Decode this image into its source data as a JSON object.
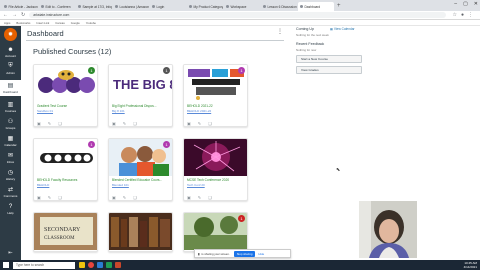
{
  "browser": {
    "tabs": [
      "File Article - Jackson Flo",
      "Edit to - Conferen",
      "Sample at 17/3, Infopage",
      "Louisianna | Amazon pres",
      "Login",
      "My Product Category",
      "Workspace",
      "Lesson 6 Discussion Posted",
      "Dashboard"
    ],
    "active_tab_index": 8,
    "url": "arkstate.instructure.com",
    "bookmarks": [
      "Apps",
      "Bookmarks",
      "Insert Link",
      "Canvas",
      "Google",
      "Youtube"
    ]
  },
  "global_nav": {
    "items": [
      {
        "label": "Account",
        "icon": "user-circle-icon"
      },
      {
        "label": "Admin",
        "icon": "shield-icon"
      },
      {
        "label": "Dashboard",
        "icon": "dashboard-icon"
      },
      {
        "label": "Courses",
        "icon": "book-icon"
      },
      {
        "label": "Groups",
        "icon": "users-icon"
      },
      {
        "label": "Calendar",
        "icon": "calendar-icon"
      },
      {
        "label": "Inbox",
        "icon": "inbox-icon"
      },
      {
        "label": "History",
        "icon": "clock-icon"
      },
      {
        "label": "Commons",
        "icon": "arrows-icon"
      },
      {
        "label": "Help",
        "icon": "help-icon"
      }
    ],
    "active_index": 2
  },
  "dashboard": {
    "title": "Dashboard",
    "section_title": "Published Courses (12)"
  },
  "courses": [
    {
      "name": "Gradient Test Course",
      "code": "Sandbox 01",
      "badge": "1",
      "badge_color": "#2d8a2d",
      "art": "mascot"
    },
    {
      "name": "Big Eight Professional Dispos...",
      "code": "Big 8 101",
      "badge": "1",
      "badge_color": "#555555",
      "art": "bigeight"
    },
    {
      "name": "BEHOLD 2021-22",
      "code": "BEHOLD 2021-22",
      "badge": "1",
      "badge_color": "#b03ab0",
      "art": "techtalk"
    },
    {
      "name": "BEHOLD Faculty Resources",
      "code": "BEHOLD",
      "badge": "1",
      "badge_color": "#b03ab0",
      "art": "behold"
    },
    {
      "name": "Blended Certified Educator Cours...",
      "code": "Blended 101",
      "badge": "1",
      "badge_color": "#b03ab0",
      "art": "kids"
    },
    {
      "name": "MCSE Tech Conference 2020",
      "code": "Tech Conf 20",
      "badge": "",
      "badge_color": "",
      "art": "plasma"
    },
    {
      "name": "Secondary Classroom",
      "code": "",
      "badge": "",
      "badge_color": "",
      "art": "secondary"
    },
    {
      "name": "Library Resources",
      "code": "",
      "badge": "",
      "badge_color": "",
      "art": "books"
    },
    {
      "name": "Outdoor Learning",
      "code": "",
      "badge": "1",
      "badge_color": "#cc2222",
      "art": "outdoor"
    }
  ],
  "sidebar": {
    "coming_up": "Coming Up",
    "calendar_link": "View Calendar",
    "nothing_for_next_week": "Nothing for the next week",
    "recent_feedback": "Recent Feedback",
    "nothing_for_now": "Nothing for now",
    "buttons": [
      "Start a New Course",
      "View Grades"
    ]
  },
  "share_bar": {
    "message": "is sharing your screen.",
    "stop_label": "Stop sharing",
    "hide_label": "Hide"
  },
  "taskbar": {
    "search_placeholder": "Type here to search",
    "time": "10:45 AM",
    "date": "4/14/2021"
  }
}
